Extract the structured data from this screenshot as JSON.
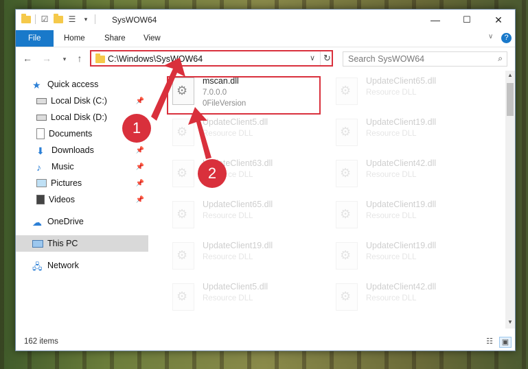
{
  "window": {
    "title": "SysWOW64",
    "controls": {
      "minimize": "—",
      "maximize": "☐",
      "close": "✕"
    }
  },
  "ribbon": {
    "tabs": [
      "File",
      "Home",
      "Share",
      "View"
    ]
  },
  "address": {
    "path": "C:\\Windows\\SysWOW64",
    "search_placeholder": "Search SysWOW64"
  },
  "nav": {
    "items": [
      {
        "label": "Quick access",
        "icon": "star-icon"
      },
      {
        "label": "Local Disk (C:)",
        "icon": "drive-icon",
        "pinned": true
      },
      {
        "label": "Local Disk (D:)",
        "icon": "drive-icon"
      },
      {
        "label": "Documents",
        "icon": "documents-icon"
      },
      {
        "label": "Downloads",
        "icon": "download-icon",
        "pinned": true
      },
      {
        "label": "Music",
        "icon": "music-icon",
        "pinned": true
      },
      {
        "label": "Pictures",
        "icon": "pictures-icon",
        "pinned": true
      },
      {
        "label": "Videos",
        "icon": "videos-icon",
        "pinned": true
      },
      {
        "label": "OneDrive",
        "icon": "cloud-icon"
      },
      {
        "label": "This PC",
        "icon": "computer-icon",
        "selected": true
      },
      {
        "label": "Network",
        "icon": "network-icon"
      }
    ]
  },
  "files": [
    {
      "name": "mscan.dll",
      "type": "7.0.0.0",
      "sub": "0FileVersion",
      "focus": true
    },
    {
      "name": "UpdateClient65.dll",
      "type": "Resource DLL"
    },
    {
      "name": "UpdateClient5.dll",
      "type": "Resource DLL"
    },
    {
      "name": "UpdateClient19.dll",
      "type": "Resource DLL"
    },
    {
      "name": "UpdateClient63.dll",
      "type": "Resource DLL"
    },
    {
      "name": "UpdateClient42.dll",
      "type": "Resource DLL"
    },
    {
      "name": "UpdateClient65.dll",
      "type": "Resource DLL"
    },
    {
      "name": "UpdateClient19.dll",
      "type": "Resource DLL"
    },
    {
      "name": "UpdateClient19.dll",
      "type": "Resource DLL"
    },
    {
      "name": "UpdateClient19.dll",
      "type": "Resource DLL"
    },
    {
      "name": "UpdateClient5.dll",
      "type": "Resource DLL"
    },
    {
      "name": "UpdateClient42.dll",
      "type": "Resource DLL"
    }
  ],
  "status": {
    "item_count": "162 items"
  },
  "annotations": {
    "badge1": "1",
    "badge2": "2"
  },
  "colors": {
    "accent": "#1979ca",
    "highlight": "#d9303c"
  }
}
